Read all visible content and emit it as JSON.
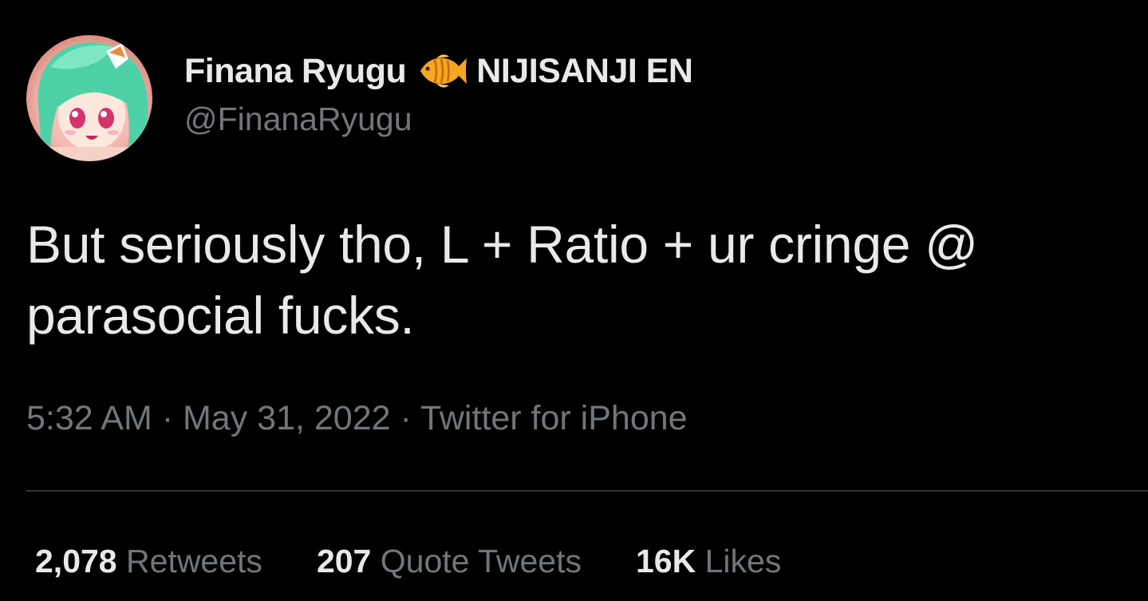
{
  "author": {
    "display_name": "Finana Ryugu",
    "name_suffix": "NIJISANJI EN",
    "handle": "@FinanaRyugu",
    "emoji_icon": "tropical-fish-icon",
    "avatar_icon": "avatar-image"
  },
  "tweet": {
    "text": "But seriously tho, L + Ratio + ur cringe @ parasocial fucks.",
    "time": "5:32 AM",
    "separator": " · ",
    "date": "May 31, 2022",
    "source": "Twitter for iPhone"
  },
  "stats": {
    "retweets_count": "2,078",
    "retweets_label": "Retweets",
    "quotes_count": "207",
    "quotes_label": "Quote Tweets",
    "likes_count": "16K",
    "likes_label": "Likes"
  },
  "colors": {
    "background": "#000000",
    "primary_text": "#e7e9ea",
    "secondary_text": "#71767b",
    "divider": "#2f3336",
    "fish": "#f5a623"
  }
}
